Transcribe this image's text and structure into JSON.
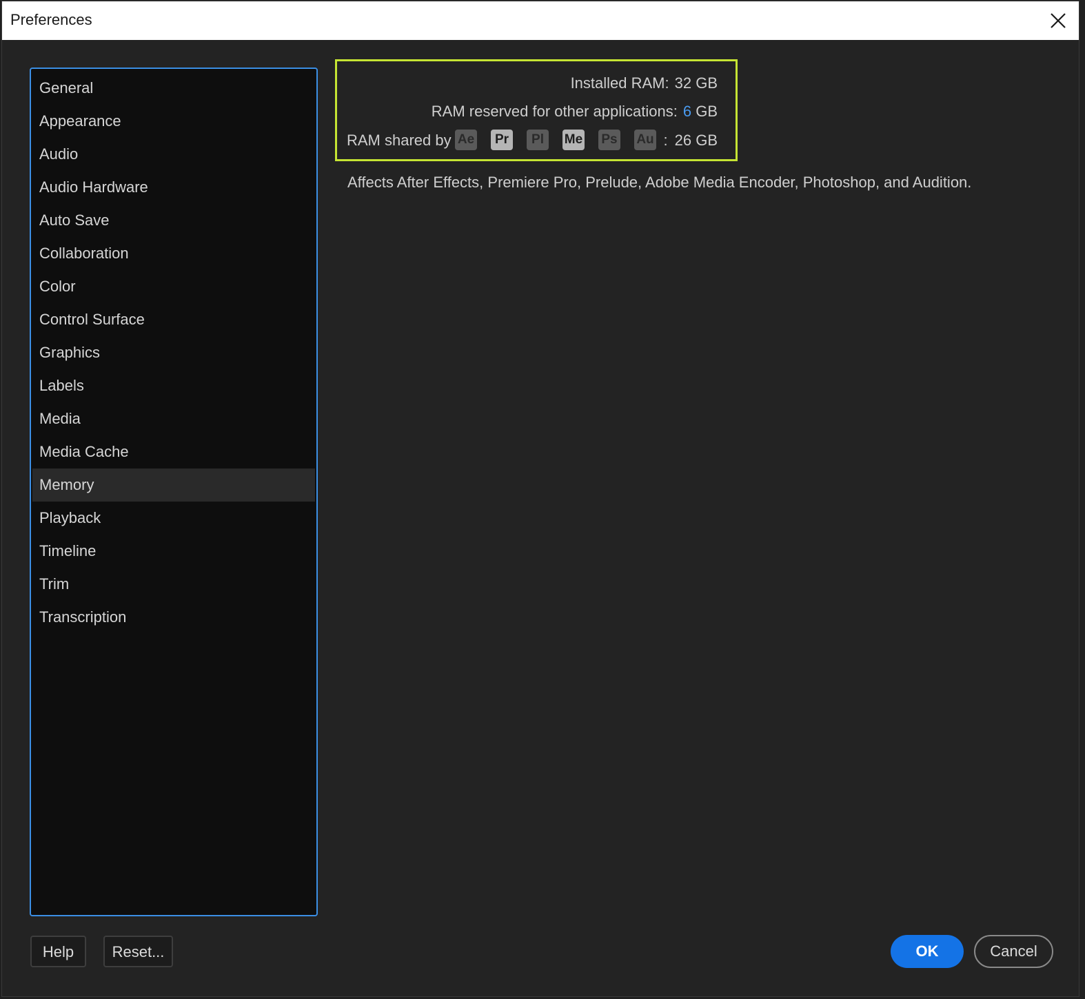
{
  "window": {
    "title": "Preferences"
  },
  "sidebar": {
    "items": [
      {
        "label": "General",
        "selected": false
      },
      {
        "label": "Appearance",
        "selected": false
      },
      {
        "label": "Audio",
        "selected": false
      },
      {
        "label": "Audio Hardware",
        "selected": false
      },
      {
        "label": "Auto Save",
        "selected": false
      },
      {
        "label": "Collaboration",
        "selected": false
      },
      {
        "label": "Color",
        "selected": false
      },
      {
        "label": "Control Surface",
        "selected": false
      },
      {
        "label": "Graphics",
        "selected": false
      },
      {
        "label": "Labels",
        "selected": false
      },
      {
        "label": "Media",
        "selected": false
      },
      {
        "label": "Media Cache",
        "selected": false
      },
      {
        "label": "Memory",
        "selected": true
      },
      {
        "label": "Playback",
        "selected": false
      },
      {
        "label": "Timeline",
        "selected": false
      },
      {
        "label": "Trim",
        "selected": false
      },
      {
        "label": "Transcription",
        "selected": false
      }
    ]
  },
  "memory": {
    "installed_label": "Installed RAM:",
    "installed_value": "32 GB",
    "reserved_label": "RAM reserved for other applications:",
    "reserved_value": "6",
    "reserved_unit": "GB",
    "shared_label": "RAM shared by",
    "apps": [
      {
        "abbr": "Ae",
        "active": false
      },
      {
        "abbr": "Pr",
        "active": true
      },
      {
        "abbr": "Pl",
        "active": false
      },
      {
        "abbr": "Me",
        "active": true
      },
      {
        "abbr": "Ps",
        "active": false
      },
      {
        "abbr": "Au",
        "active": false
      }
    ],
    "shared_colon": ":",
    "shared_value": "26 GB",
    "note": "Affects After Effects, Premiere Pro, Prelude, Adobe Media Encoder, Photoshop, and Audition."
  },
  "buttons": {
    "help": "Help",
    "reset": "Reset...",
    "ok": "OK",
    "cancel": "Cancel"
  },
  "colors": {
    "accent": "#1473e6",
    "highlight_box": "#c5e433",
    "link": "#4a9bf0",
    "focus_border": "#3b8fe5"
  }
}
